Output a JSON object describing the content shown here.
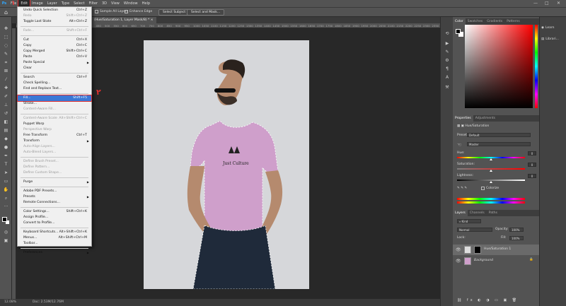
{
  "menubar": {
    "logo": "Ps",
    "items": [
      "File",
      "Edit",
      "Image",
      "Layer",
      "Type",
      "Select",
      "Filter",
      "3D",
      "View",
      "Window",
      "Help"
    ],
    "active": "Edit",
    "window_controls": [
      "—",
      "□",
      "✕"
    ]
  },
  "options_bar": {
    "home_icon": "home-icon",
    "sample_all_layers": "Sample All Layers",
    "enhance_edge": "Enhance Edge",
    "select_subject": "Select Subject",
    "select_and_mask": "Select and Mask..."
  },
  "document": {
    "tab_title": "(Hue/Saturation 1, Layer Mask/8) *",
    "tab_close": "×",
    "ruler_ticks": [
      "0",
      "50",
      "100",
      "150",
      "200",
      "250",
      "300",
      "350",
      "400",
      "450",
      "500",
      "550",
      "600",
      "650",
      "700",
      "750",
      "800",
      "850",
      "900",
      "950",
      "1000",
      "1050",
      "1100",
      "1150",
      "1200",
      "1250",
      "1300",
      "1350",
      "1400",
      "1450",
      "1500",
      "1550",
      "1600",
      "1650",
      "1700",
      "1750",
      "1800",
      "1850",
      "1900",
      "1950",
      "2000",
      "2050",
      "2100",
      "2150",
      "2200",
      "2250",
      "2300",
      "2350",
      "2400"
    ],
    "zoom": "12.08%",
    "doc_size": "Doc: 2.53M/12.76M",
    "shirt_text": "Just Culture"
  },
  "edit_menu": {
    "items": [
      {
        "label": "Undo Quick Selection",
        "shortcut": "Ctrl+Z",
        "disabled": false
      },
      {
        "label": "Redo",
        "shortcut": "Shift+Ctrl+Z",
        "disabled": true
      },
      {
        "label": "Toggle Last State",
        "shortcut": "Alt+Ctrl+Z",
        "disabled": false
      },
      {
        "sep": true
      },
      {
        "label": "Fade...",
        "shortcut": "Shift+Ctrl+F",
        "disabled": true
      },
      {
        "sep": true
      },
      {
        "label": "Cut",
        "shortcut": "Ctrl+X",
        "disabled": false
      },
      {
        "label": "Copy",
        "shortcut": "Ctrl+C",
        "disabled": false
      },
      {
        "label": "Copy Merged",
        "shortcut": "Shift+Ctrl+C",
        "disabled": false
      },
      {
        "label": "Paste",
        "shortcut": "Ctrl+V",
        "disabled": false
      },
      {
        "label": "Paste Special",
        "shortcut": "",
        "disabled": false,
        "submenu": true
      },
      {
        "label": "Clear",
        "shortcut": "",
        "disabled": false
      },
      {
        "sep": true
      },
      {
        "label": "Search",
        "shortcut": "Ctrl+F",
        "disabled": false
      },
      {
        "label": "Check Spelling...",
        "shortcut": "",
        "disabled": false
      },
      {
        "label": "Find and Replace Text...",
        "shortcut": "",
        "disabled": false
      },
      {
        "sep": true
      },
      {
        "label": "Fill...",
        "shortcut": "Shift+F5",
        "disabled": false,
        "highlight": true
      },
      {
        "label": "Stroke...",
        "shortcut": "",
        "disabled": false
      },
      {
        "label": "Content-Aware Fill...",
        "shortcut": "",
        "disabled": true
      },
      {
        "sep": true
      },
      {
        "label": "Content-Aware Scale",
        "shortcut": "Alt+Shift+Ctrl+C",
        "disabled": true
      },
      {
        "label": "Puppet Warp",
        "shortcut": "",
        "disabled": false
      },
      {
        "label": "Perspective Warp",
        "shortcut": "",
        "disabled": true
      },
      {
        "label": "Free Transform",
        "shortcut": "Ctrl+T",
        "disabled": false
      },
      {
        "label": "Transform",
        "shortcut": "",
        "disabled": false,
        "submenu": true
      },
      {
        "label": "Auto-Align Layers...",
        "shortcut": "",
        "disabled": true
      },
      {
        "label": "Auto-Blend Layers...",
        "shortcut": "",
        "disabled": true
      },
      {
        "sep": true
      },
      {
        "label": "Define Brush Preset...",
        "shortcut": "",
        "disabled": true
      },
      {
        "label": "Define Pattern...",
        "shortcut": "",
        "disabled": true
      },
      {
        "label": "Define Custom Shape...",
        "shortcut": "",
        "disabled": true
      },
      {
        "sep": true
      },
      {
        "label": "Purge",
        "shortcut": "",
        "disabled": false,
        "submenu": true
      },
      {
        "sep": true
      },
      {
        "label": "Adobe PDF Presets...",
        "shortcut": "",
        "disabled": false
      },
      {
        "label": "Presets",
        "shortcut": "",
        "disabled": false,
        "submenu": true
      },
      {
        "label": "Remote Connections...",
        "shortcut": "",
        "disabled": false
      },
      {
        "sep": true
      },
      {
        "label": "Color Settings...",
        "shortcut": "Shift+Ctrl+K",
        "disabled": false
      },
      {
        "label": "Assign Profile...",
        "shortcut": "",
        "disabled": false
      },
      {
        "label": "Convert to Profile...",
        "shortcut": "",
        "disabled": false
      },
      {
        "sep": true
      },
      {
        "label": "Keyboard Shortcuts...",
        "shortcut": "Alt+Shift+Ctrl+K",
        "disabled": false
      },
      {
        "label": "Menus...",
        "shortcut": "Alt+Shift+Ctrl+M",
        "disabled": false
      },
      {
        "label": "Toolbar...",
        "shortcut": "",
        "disabled": false
      },
      {
        "sep": true
      },
      {
        "label": "Preferences",
        "shortcut": "",
        "disabled": false,
        "submenu": true
      }
    ]
  },
  "annotations": {
    "step1": "۱",
    "step2": "۲",
    "color": "#e03030"
  },
  "color_panel": {
    "tabs": [
      "Color",
      "Swatches",
      "Gradients",
      "Patterns"
    ]
  },
  "properties_panel": {
    "tabs": [
      "Properties",
      "Adjustments"
    ],
    "adjustment_name": "Hue/Saturation",
    "preset_label": "Preset:",
    "preset_value": "Default",
    "channel_value": "Master",
    "hue_label": "Hue:",
    "hue_value": "0",
    "saturation_label": "Saturation:",
    "saturation_value": "0",
    "lightness_label": "Lightness:",
    "lightness_value": "0",
    "colorize_label": "Colorize"
  },
  "layers_panel": {
    "tabs": [
      "Layers",
      "Channels",
      "Paths"
    ],
    "kind_label": "Kind",
    "blend_mode": "Normal",
    "opacity_label": "Opacity:",
    "opacity_value": "100%",
    "lock_label": "Lock:",
    "fill_label": "Fill:",
    "fill_value": "100%",
    "layers": [
      {
        "name": "Hue/Saturation 1",
        "selected": true
      },
      {
        "name": "Background",
        "selected": false
      }
    ]
  },
  "right_dock": {
    "items": [
      "Learn",
      "Librari..."
    ]
  }
}
